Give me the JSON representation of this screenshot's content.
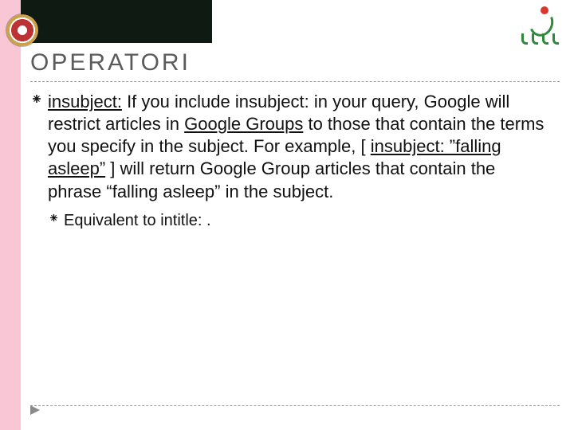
{
  "slide": {
    "title": "OPERATORI",
    "body": {
      "parts": [
        {
          "t": "insubject:",
          "u": true
        },
        {
          "t": " If you include insubject: in your query, Google will restrict articles in "
        },
        {
          "t": "Google Groups",
          "u": true
        },
        {
          "t": " to those that contain the terms you specify in the subject. For example, [ "
        },
        {
          "t": "insubject: ”falling asleep”",
          "u": true
        },
        {
          "t": " ] will return Google Group articles that contain the phrase “falling asleep” in the subject."
        }
      ]
    },
    "sub": "Equivalent to intitle: ."
  },
  "colors": {
    "leftbar": "#f8c6d4",
    "topdark": "#0f1b12",
    "title": "#5b5b5b",
    "dash": "#9a9a9a",
    "text": "#111111"
  }
}
